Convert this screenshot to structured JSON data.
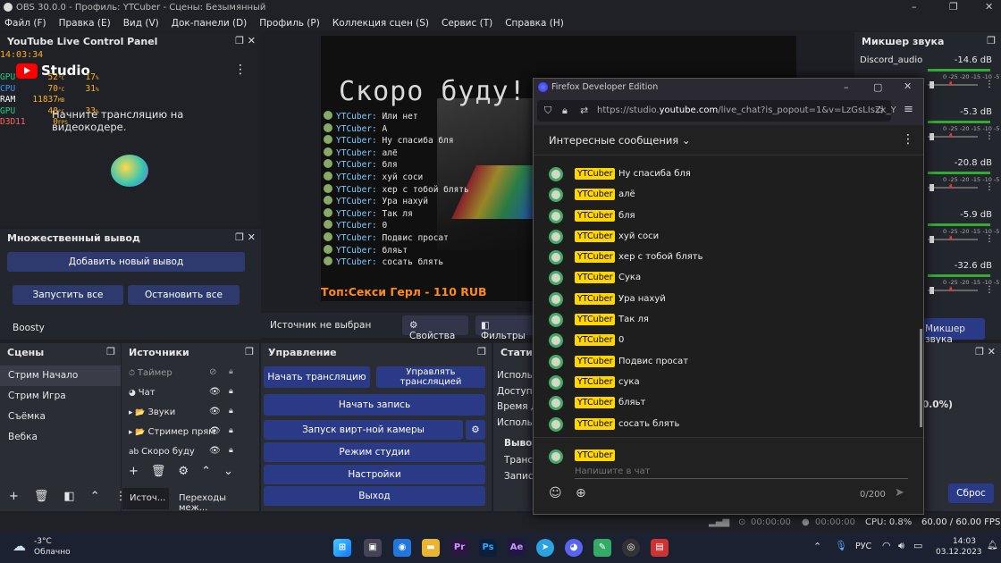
{
  "window": {
    "title": "OBS 30.0.0 - Профиль: YTCuber - Сцены: Безымянный"
  },
  "menu": [
    "Файл (F)",
    "Правка (E)",
    "Вид (V)",
    "Док-панели (D)",
    "Профиль (P)",
    "Коллекция сцен (S)",
    "Сервис (T)",
    "Справка (H)"
  ],
  "yt_panel": {
    "title": "YouTube Live Control Panel",
    "studio": "Studio",
    "message": "Начните трансляцию на видеокодере.",
    "clock": "14:03:34",
    "stats": [
      {
        "k": "GPU",
        "v": "52",
        "u": "°C",
        "v2": "17",
        "u2": "%"
      },
      {
        "k": "CPU",
        "v": "70",
        "u": "°C",
        "v2": "31",
        "u2": "%"
      },
      {
        "k": "RAM",
        "v": "11837",
        "u": "MB"
      },
      {
        "k": "GPU",
        "v": "48",
        "u": "°C",
        "v2": "33",
        "u2": "%"
      },
      {
        "k": "D3D11",
        "v": "0",
        "u": "FPS"
      }
    ]
  },
  "multi": {
    "title": "Множественный вывод",
    "add": "Добавить новый вывод",
    "start_all": "Запустить все",
    "stop_all": "Остановить все",
    "item": "Boosty"
  },
  "preview": {
    "overlay_text": "Скоро буду!",
    "bottom_text": "Топ:Секси Герл - 110 RUB",
    "chat": [
      {
        "n": "YTCuber:",
        "m": "Или нет"
      },
      {
        "n": "YTCuber:",
        "m": "А"
      },
      {
        "n": "YTCuber:",
        "m": "Ну спасиба бля"
      },
      {
        "n": "YTCuber:",
        "m": "алё"
      },
      {
        "n": "YTCuber:",
        "m": "бля"
      },
      {
        "n": "YTCuber:",
        "m": "хуй соси"
      },
      {
        "n": "YTCuber:",
        "m": "хер с тобой блять"
      },
      {
        "n": "YTCuber:",
        "m": "Ура нахуй"
      },
      {
        "n": "YTCuber:",
        "m": "Так ля"
      },
      {
        "n": "YTCuber:",
        "m": "0"
      },
      {
        "n": "YTCuber:",
        "m": "Подвис просат"
      },
      {
        "n": "YTCuber:",
        "m": "бляьт"
      },
      {
        "n": "YTCuber:",
        "m": "сосать блять"
      }
    ]
  },
  "source_bar": {
    "none": "Источник не выбран",
    "props": "Свойства",
    "filters": "Фильтры"
  },
  "mixer": {
    "title": "Микшер звука",
    "channels": [
      {
        "name": "Discord_audio",
        "db": "-14.6 dB"
      },
      {
        "name": "",
        "db": "-5.3 dB"
      },
      {
        "name": "",
        "db": "-20.8 dB"
      },
      {
        "name": "",
        "db": "-5.9 dB"
      },
      {
        "name": "",
        "db": "-32.6 dB"
      }
    ],
    "scale": "0 -25 -20 -15 -10 -5 0",
    "tab": "Микшер звука"
  },
  "scenes": {
    "title": "Сцены",
    "items": [
      "Стрим Начало",
      "Стрим Игра",
      "Съёмка",
      "Вебка"
    ]
  },
  "sources": {
    "title": "Источники",
    "items": [
      "Таймер",
      "Чат",
      "Звуки",
      "Стример прям",
      "Скоро буду"
    ],
    "tab1": "Источ...",
    "tab2": "Переходы меж..."
  },
  "controls": {
    "title": "Управление",
    "start_stream": "Начать трансляцию",
    "manage_stream": "Управлять трансляцией",
    "record": "Начать запись",
    "vcam": "Запуск вирт-ной камеры",
    "studio": "Режим студии",
    "settings": "Настройки",
    "exit": "Выход"
  },
  "stats_panel": {
    "title": "Статис",
    "rows": [
      "Использ",
      "Доступн",
      "Время до",
      "Использ"
    ],
    "out": "Вывод",
    "rows2": [
      "Трансл",
      "Запись"
    ],
    "pct": "0.0%)",
    "reset": "Сброс"
  },
  "status": {
    "t1": "00:00:00",
    "t2": "00:00:00",
    "cpu": "CPU: 0.8%",
    "fps": "60.00 / 60.00 FPS"
  },
  "firefox": {
    "title": "Firefox Developer Edition",
    "url_pre": "https://studio.",
    "url_host": "youtube.com",
    "url_post": "/live_chat?is_popout=1&v=LzGsLIsZk_Y",
    "filter": "Интересные сообщения",
    "messages": [
      {
        "a": "YTCuber",
        "m": "Ну спасиба бля"
      },
      {
        "a": "YTCuber",
        "m": "алё"
      },
      {
        "a": "YTCuber",
        "m": "бля"
      },
      {
        "a": "YTCuber",
        "m": "хуй соси"
      },
      {
        "a": "YTCuber",
        "m": "хер с тобой блять"
      },
      {
        "a": "YTCuber",
        "m": "Сука"
      },
      {
        "a": "YTCuber",
        "m": "Ура нахуй"
      },
      {
        "a": "YTCuber",
        "m": "Так ля"
      },
      {
        "a": "YTCuber",
        "m": "0"
      },
      {
        "a": "YTCuber",
        "m": "Подвис просат"
      },
      {
        "a": "YTCuber",
        "m": "сука"
      },
      {
        "a": "YTCuber",
        "m": "бляьт"
      },
      {
        "a": "YTCuber",
        "m": "сосать блять"
      }
    ],
    "composer_name": "YTCuber",
    "placeholder": "Напишите в чат",
    "counter": "0/200"
  },
  "taskbar": {
    "temp": "-3°C",
    "weather": "Облачно",
    "lang": "РУС",
    "time": "14:03",
    "date": "03.12.2023"
  }
}
